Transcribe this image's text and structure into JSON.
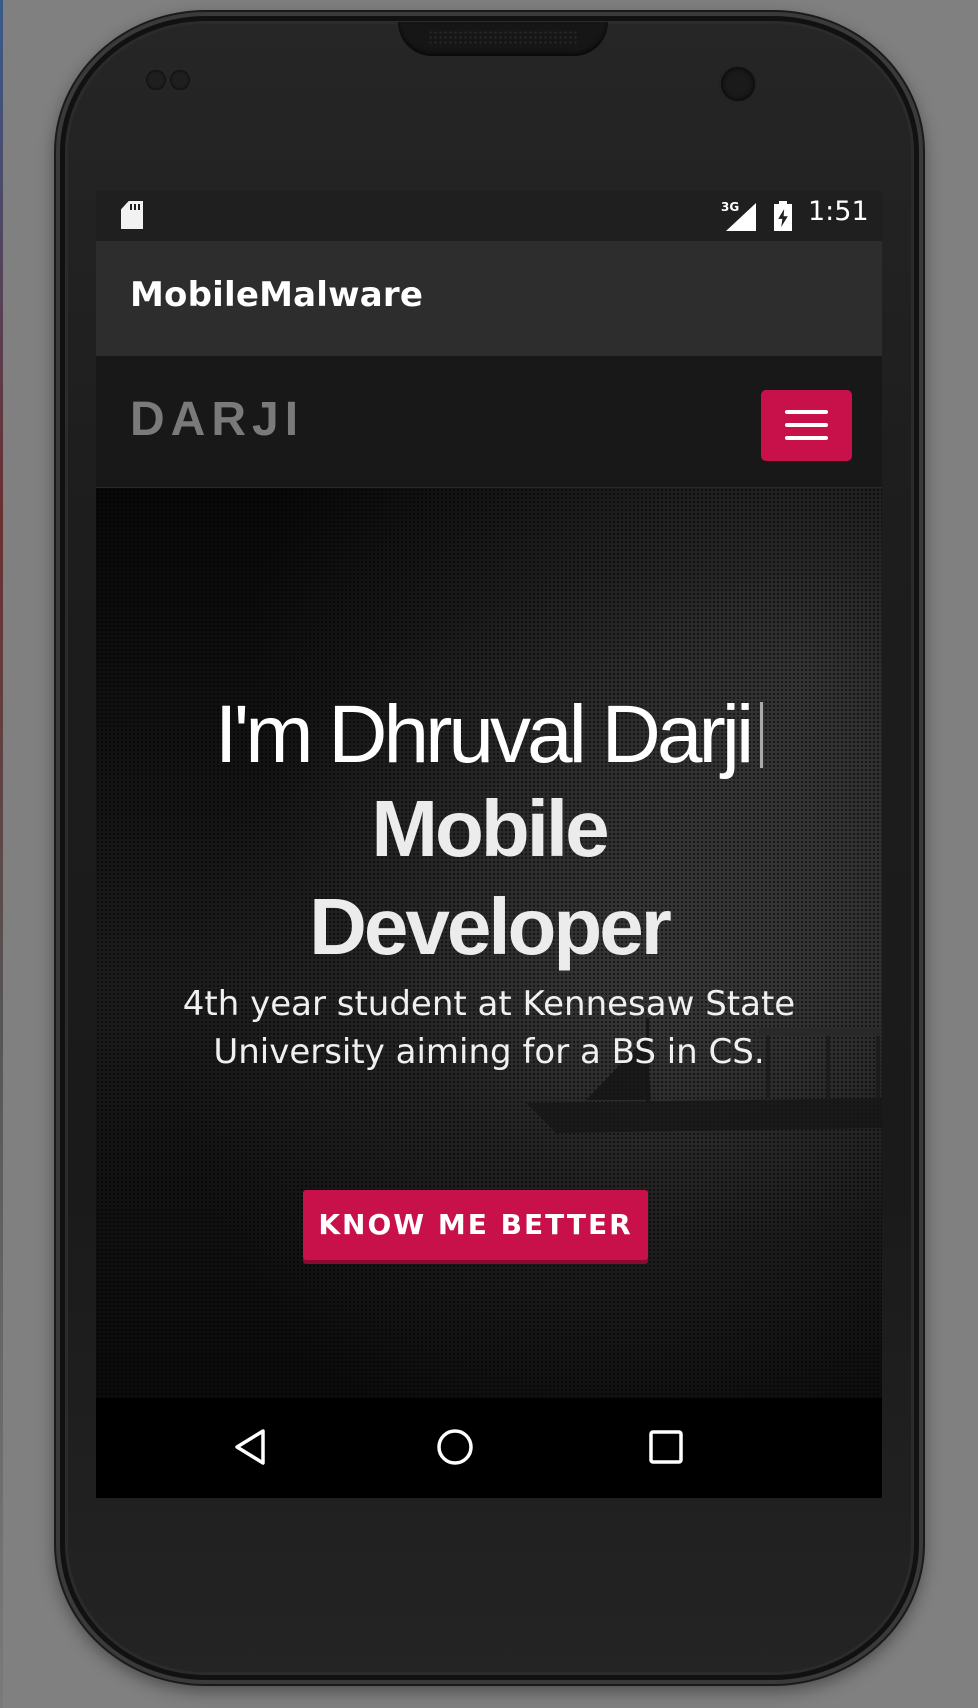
{
  "device": {
    "frame": "Android phone emulator"
  },
  "status_bar": {
    "network_type": "3G",
    "time": "1:51",
    "icons": [
      "sd-card-icon",
      "signal-icon",
      "battery-charging-icon"
    ]
  },
  "app_bar": {
    "title": "MobileMalware"
  },
  "site": {
    "brand": "DARJI",
    "menu_icon": "hamburger-menu-icon",
    "accent_color": "#c8104b"
  },
  "hero": {
    "intro": "I'm Dhruval Darji",
    "role_line1": "Mobile",
    "role_line2": "Developer",
    "subtitle": "4th year student at Kennesaw State University aiming for a BS in CS.",
    "cta_label": "KNOW ME BETTER"
  },
  "nav_bar": {
    "buttons": [
      "back-icon",
      "home-icon",
      "recents-icon"
    ]
  }
}
